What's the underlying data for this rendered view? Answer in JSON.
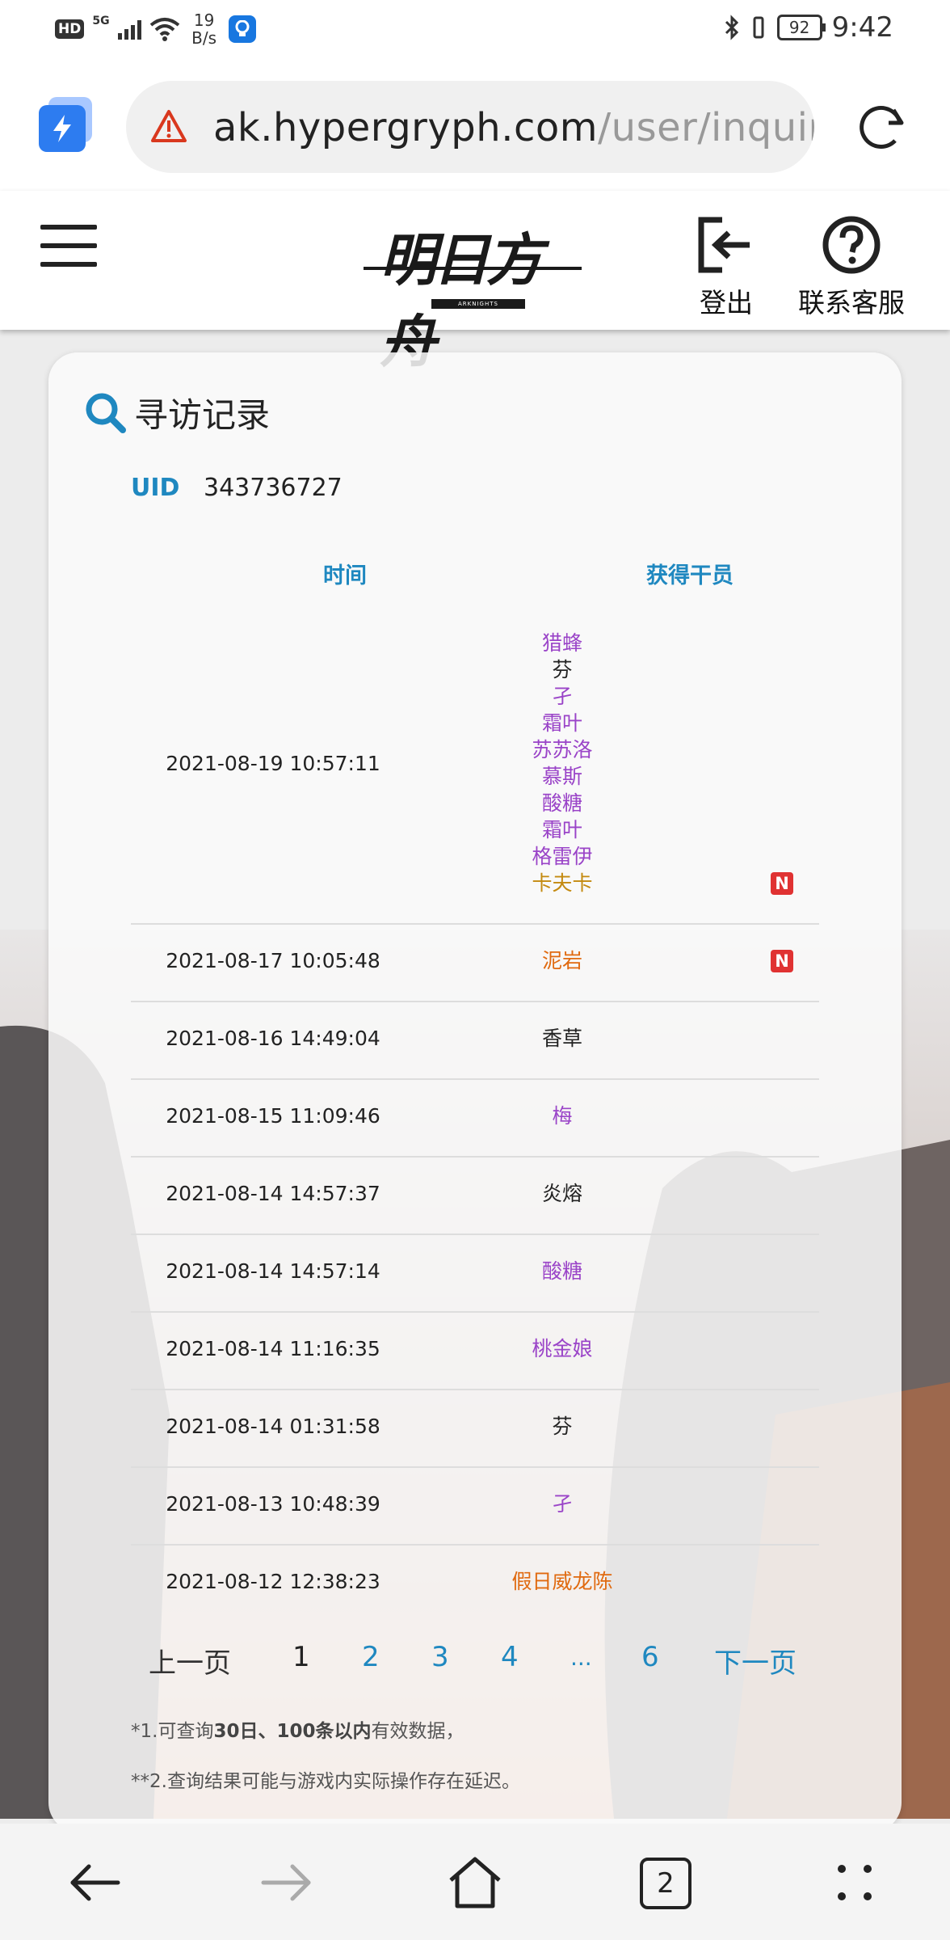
{
  "status_bar": {
    "hd": "HD",
    "network": "5G",
    "speed_value": "19",
    "speed_unit": "B/s",
    "battery": "92",
    "time": "9:42"
  },
  "browser": {
    "url_host": "ak.hypergryph.com",
    "url_path": "/user/inquiryG",
    "tab_count": "2"
  },
  "header": {
    "logo_text": "明日方舟",
    "logo_sub": "ARKNIGHTS",
    "logout_label": "登出",
    "support_label": "联系客服"
  },
  "card": {
    "title": "寻访记录",
    "uid_label": "UID",
    "uid_value": "343736727",
    "col_time": "时间",
    "col_operator": "获得干员"
  },
  "records": [
    {
      "time": "2021-08-19 10:57:11",
      "operators": [
        {
          "name": "猎蜂",
          "color": "purple"
        },
        {
          "name": "芬",
          "color": "black"
        },
        {
          "name": "孑",
          "color": "purple"
        },
        {
          "name": "霜叶",
          "color": "purple"
        },
        {
          "name": "苏苏洛",
          "color": "purple"
        },
        {
          "name": "慕斯",
          "color": "purple"
        },
        {
          "name": "酸糖",
          "color": "purple"
        },
        {
          "name": "霜叶",
          "color": "purple"
        },
        {
          "name": "格雷伊",
          "color": "purple"
        },
        {
          "name": "卡夫卡",
          "color": "gold",
          "new": "N"
        }
      ]
    },
    {
      "time": "2021-08-17 10:05:48",
      "operators": [
        {
          "name": "泥岩",
          "color": "orange",
          "new": "N"
        }
      ]
    },
    {
      "time": "2021-08-16 14:49:04",
      "operators": [
        {
          "name": "香草",
          "color": "black"
        }
      ]
    },
    {
      "time": "2021-08-15 11:09:46",
      "operators": [
        {
          "name": "梅",
          "color": "purple"
        }
      ]
    },
    {
      "time": "2021-08-14 14:57:37",
      "operators": [
        {
          "name": "炎熔",
          "color": "black"
        }
      ]
    },
    {
      "time": "2021-08-14 14:57:14",
      "operators": [
        {
          "name": "酸糖",
          "color": "purple"
        }
      ]
    },
    {
      "time": "2021-08-14 11:16:35",
      "operators": [
        {
          "name": "桃金娘",
          "color": "purple"
        }
      ]
    },
    {
      "time": "2021-08-14 01:31:58",
      "operators": [
        {
          "name": "芬",
          "color": "black"
        }
      ]
    },
    {
      "time": "2021-08-13 10:48:39",
      "operators": [
        {
          "name": "孑",
          "color": "purple"
        }
      ]
    },
    {
      "time": "2021-08-12 12:38:23",
      "operators": [
        {
          "name": "假日威龙陈",
          "color": "orange"
        }
      ]
    }
  ],
  "pager": {
    "prev": "上一页",
    "pages": [
      "1",
      "2",
      "3",
      "4",
      "...",
      "6"
    ],
    "current": "1",
    "next": "下一页"
  },
  "notes": {
    "note1_prefix": "*1.可查询",
    "note1_bold": "30日、100条以内",
    "note1_suffix": "有效数据，",
    "note2": "**2.查询结果可能与游戏内实际操作存在延迟。"
  },
  "colors": {
    "accent": "#1f88c0",
    "rarity_purple": "#9a44c8",
    "rarity_gold": "#c48a10",
    "rarity_orange": "#e06a10",
    "new_badge": "#e03232"
  }
}
